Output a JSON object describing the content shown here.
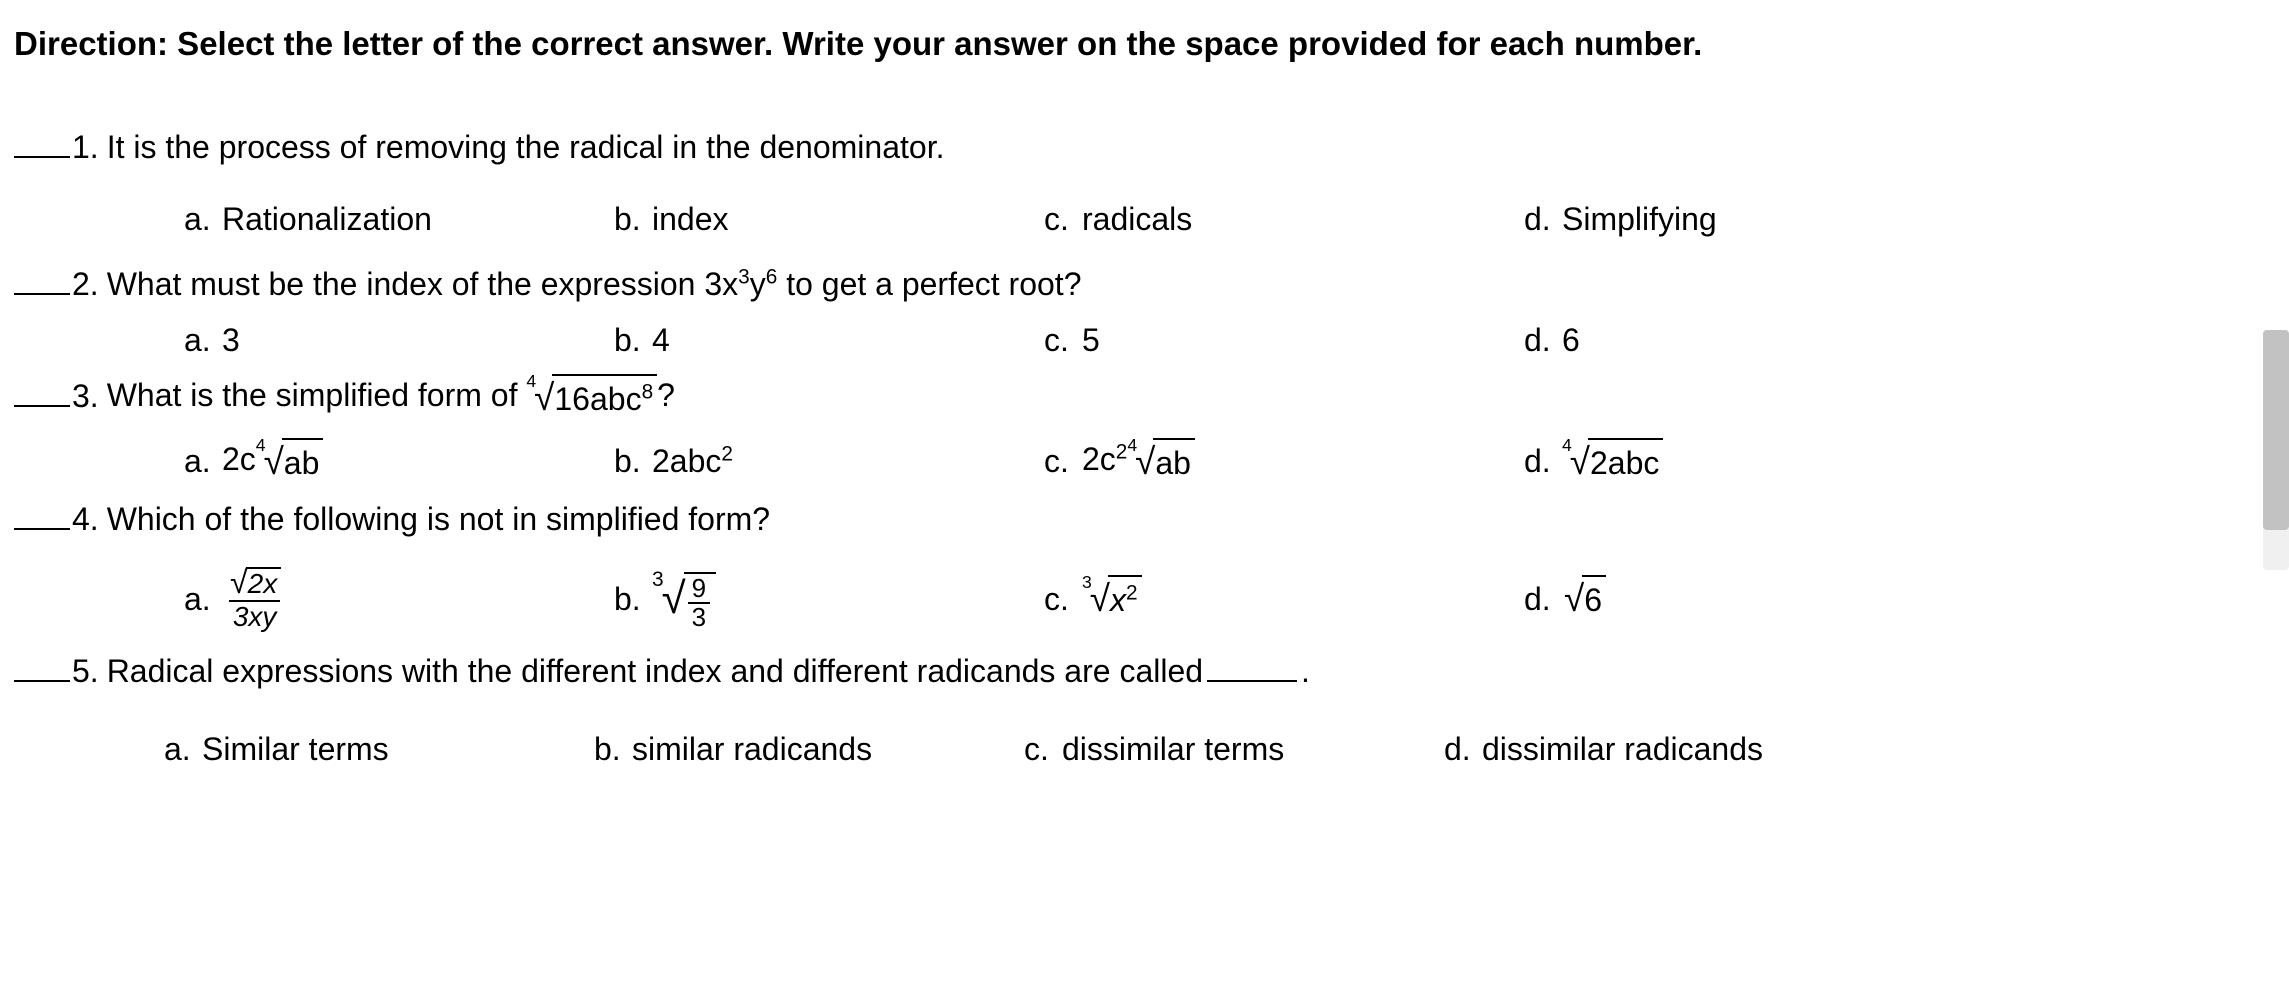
{
  "direction": "Direction: Select the letter of the correct answer. Write your answer on the space provided for each number.",
  "q1": {
    "num": "1.",
    "text": "It is the process of removing the radical in the denominator.",
    "a": "Rationalization",
    "b": "index",
    "c": "radicals",
    "d": "Simplifying"
  },
  "q2": {
    "num": "2.",
    "prefix": "What must be the index of the expression 3x",
    "exp1": "3",
    "mid": "y",
    "exp2": "6",
    "suffix": " to get a perfect root?",
    "a": "3",
    "b": "4",
    "c": "5",
    "d": "6"
  },
  "q3": {
    "num": "3.",
    "prefix": "What is the simplified form of ",
    "idx": "4",
    "radicand_pre": "16abc",
    "radicand_exp": "8",
    "suffix": "?",
    "a_pre": "2c",
    "a_idx": "4",
    "a_rad": "ab",
    "b_pre": "2abc",
    "b_exp": "2",
    "c_pre": "2c",
    "c_exp": "2",
    "c_idx": "4",
    "c_rad": "ab",
    "d_idx": "4",
    "d_rad": "2abc"
  },
  "q4": {
    "num": "4.",
    "text": "Which of the following is not in simplified form?",
    "a_num_rad": "2x",
    "a_den": "3xy",
    "b_idx": "3",
    "b_frac_num": "9",
    "b_frac_den": "3",
    "c_idx": "3",
    "c_rad_base": "x",
    "c_rad_exp": "2",
    "d_rad": "6"
  },
  "q5": {
    "num": "5.",
    "text": "Radical expressions with the different index and different radicands are called",
    "period": ".",
    "a": "Similar terms",
    "b": "similar radicands",
    "c": "dissimilar terms",
    "d": "dissimilar radicands"
  },
  "letters": {
    "a": "a.",
    "b": "b.",
    "c": "c.",
    "d": "d."
  }
}
